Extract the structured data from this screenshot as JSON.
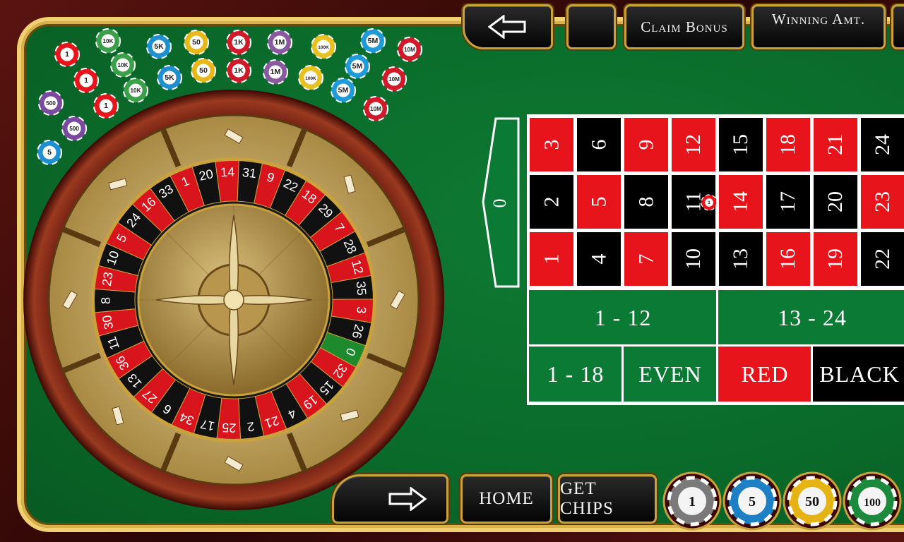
{
  "top_bar": {
    "claim_bonus": "Claim Bonus",
    "winning_amt": "Winning Amt."
  },
  "bottom_bar": {
    "home": "HOME",
    "get_chips": "GET CHIPS"
  },
  "tray_chips": [
    {
      "label": "1",
      "color": "#7a7a7a"
    },
    {
      "label": "5",
      "color": "#1d7fc4"
    },
    {
      "label": "50",
      "color": "#e5b314"
    },
    {
      "label": "100",
      "color": "#1c8a3c"
    }
  ],
  "chip_stack": [
    "1",
    "10K",
    "5K",
    "50",
    "1K",
    "1M",
    "100K",
    "5M",
    "10M",
    "500"
  ],
  "wheel_numbers": [
    "0",
    "32",
    "15",
    "19",
    "4",
    "21",
    "2",
    "25",
    "17",
    "34",
    "6",
    "27",
    "13",
    "36",
    "11",
    "30",
    "8",
    "23",
    "10",
    "5",
    "24",
    "16",
    "33",
    "1",
    "20",
    "14",
    "31",
    "9",
    "22",
    "18",
    "29",
    "7",
    "28",
    "12",
    "35",
    "3",
    "26"
  ],
  "table": {
    "zero": "0",
    "rows": [
      [
        {
          "n": "3",
          "c": "red"
        },
        {
          "n": "6",
          "c": "black"
        },
        {
          "n": "9",
          "c": "red"
        },
        {
          "n": "12",
          "c": "red"
        },
        {
          "n": "15",
          "c": "black"
        },
        {
          "n": "18",
          "c": "red"
        },
        {
          "n": "21",
          "c": "red"
        },
        {
          "n": "24",
          "c": "black"
        }
      ],
      [
        {
          "n": "2",
          "c": "black"
        },
        {
          "n": "5",
          "c": "red"
        },
        {
          "n": "8",
          "c": "black"
        },
        {
          "n": "11",
          "c": "black"
        },
        {
          "n": "14",
          "c": "red"
        },
        {
          "n": "17",
          "c": "black"
        },
        {
          "n": "20",
          "c": "black"
        },
        {
          "n": "23",
          "c": "red"
        }
      ],
      [
        {
          "n": "1",
          "c": "red"
        },
        {
          "n": "4",
          "c": "black"
        },
        {
          "n": "7",
          "c": "red"
        },
        {
          "n": "10",
          "c": "black"
        },
        {
          "n": "13",
          "c": "black"
        },
        {
          "n": "16",
          "c": "red"
        },
        {
          "n": "19",
          "c": "red"
        },
        {
          "n": "22",
          "c": "black"
        }
      ]
    ],
    "dozens": [
      "1 - 12",
      "13 - 24"
    ],
    "even_money": [
      "1 - 18",
      "EVEN",
      "RED",
      "BLACK"
    ]
  },
  "placed_chip": {
    "label": "1",
    "on": "8/11 split"
  },
  "colors": {
    "felt": "#0a6a2a",
    "red": "#e8141c",
    "black": "#000000",
    "gold": "#d9b24a"
  }
}
